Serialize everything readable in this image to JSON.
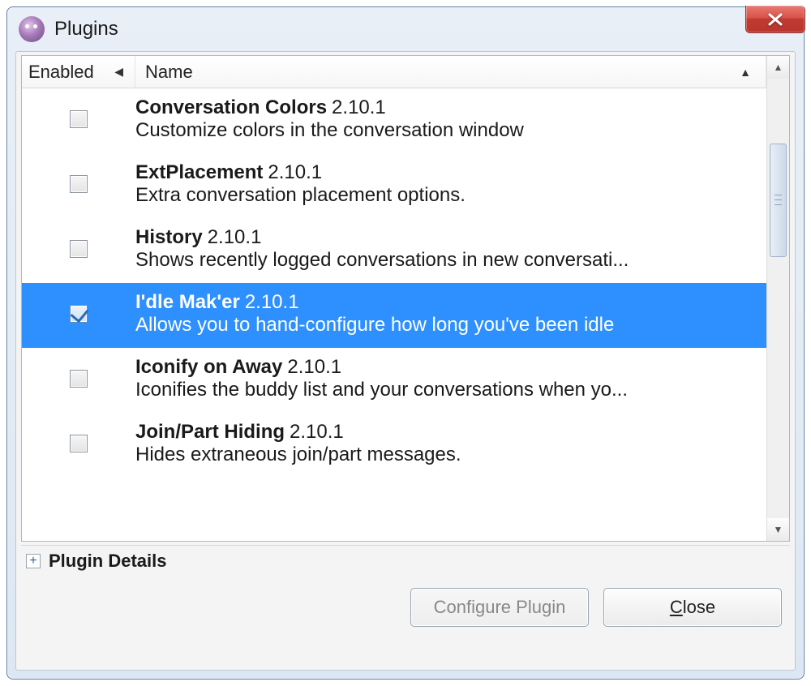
{
  "window": {
    "title": "Plugins"
  },
  "columns": {
    "enabled": "Enabled",
    "name": "Name"
  },
  "plugins": [
    {
      "name": "Conversation Colors",
      "version": "2.10.1",
      "desc": "Customize colors in the conversation window",
      "enabled": false,
      "selected": false
    },
    {
      "name": "ExtPlacement",
      "version": "2.10.1",
      "desc": "Extra conversation placement options.",
      "enabled": false,
      "selected": false
    },
    {
      "name": "History",
      "version": "2.10.1",
      "desc": "Shows recently logged conversations in new conversati...",
      "enabled": false,
      "selected": false
    },
    {
      "name": "I'dle Mak'er",
      "version": "2.10.1",
      "desc": "Allows you to hand-configure how long you've been idle",
      "enabled": true,
      "selected": true
    },
    {
      "name": "Iconify on Away",
      "version": "2.10.1",
      "desc": "Iconifies the buddy list and your conversations when yo...",
      "enabled": false,
      "selected": false
    },
    {
      "name": "Join/Part Hiding",
      "version": "2.10.1",
      "desc": "Hides extraneous join/part messages.",
      "enabled": false,
      "selected": false
    }
  ],
  "details": {
    "label": "Plugin Details"
  },
  "buttons": {
    "configure": "Configure Plugin",
    "close_pre": "",
    "close_u": "C",
    "close_post": "lose"
  }
}
